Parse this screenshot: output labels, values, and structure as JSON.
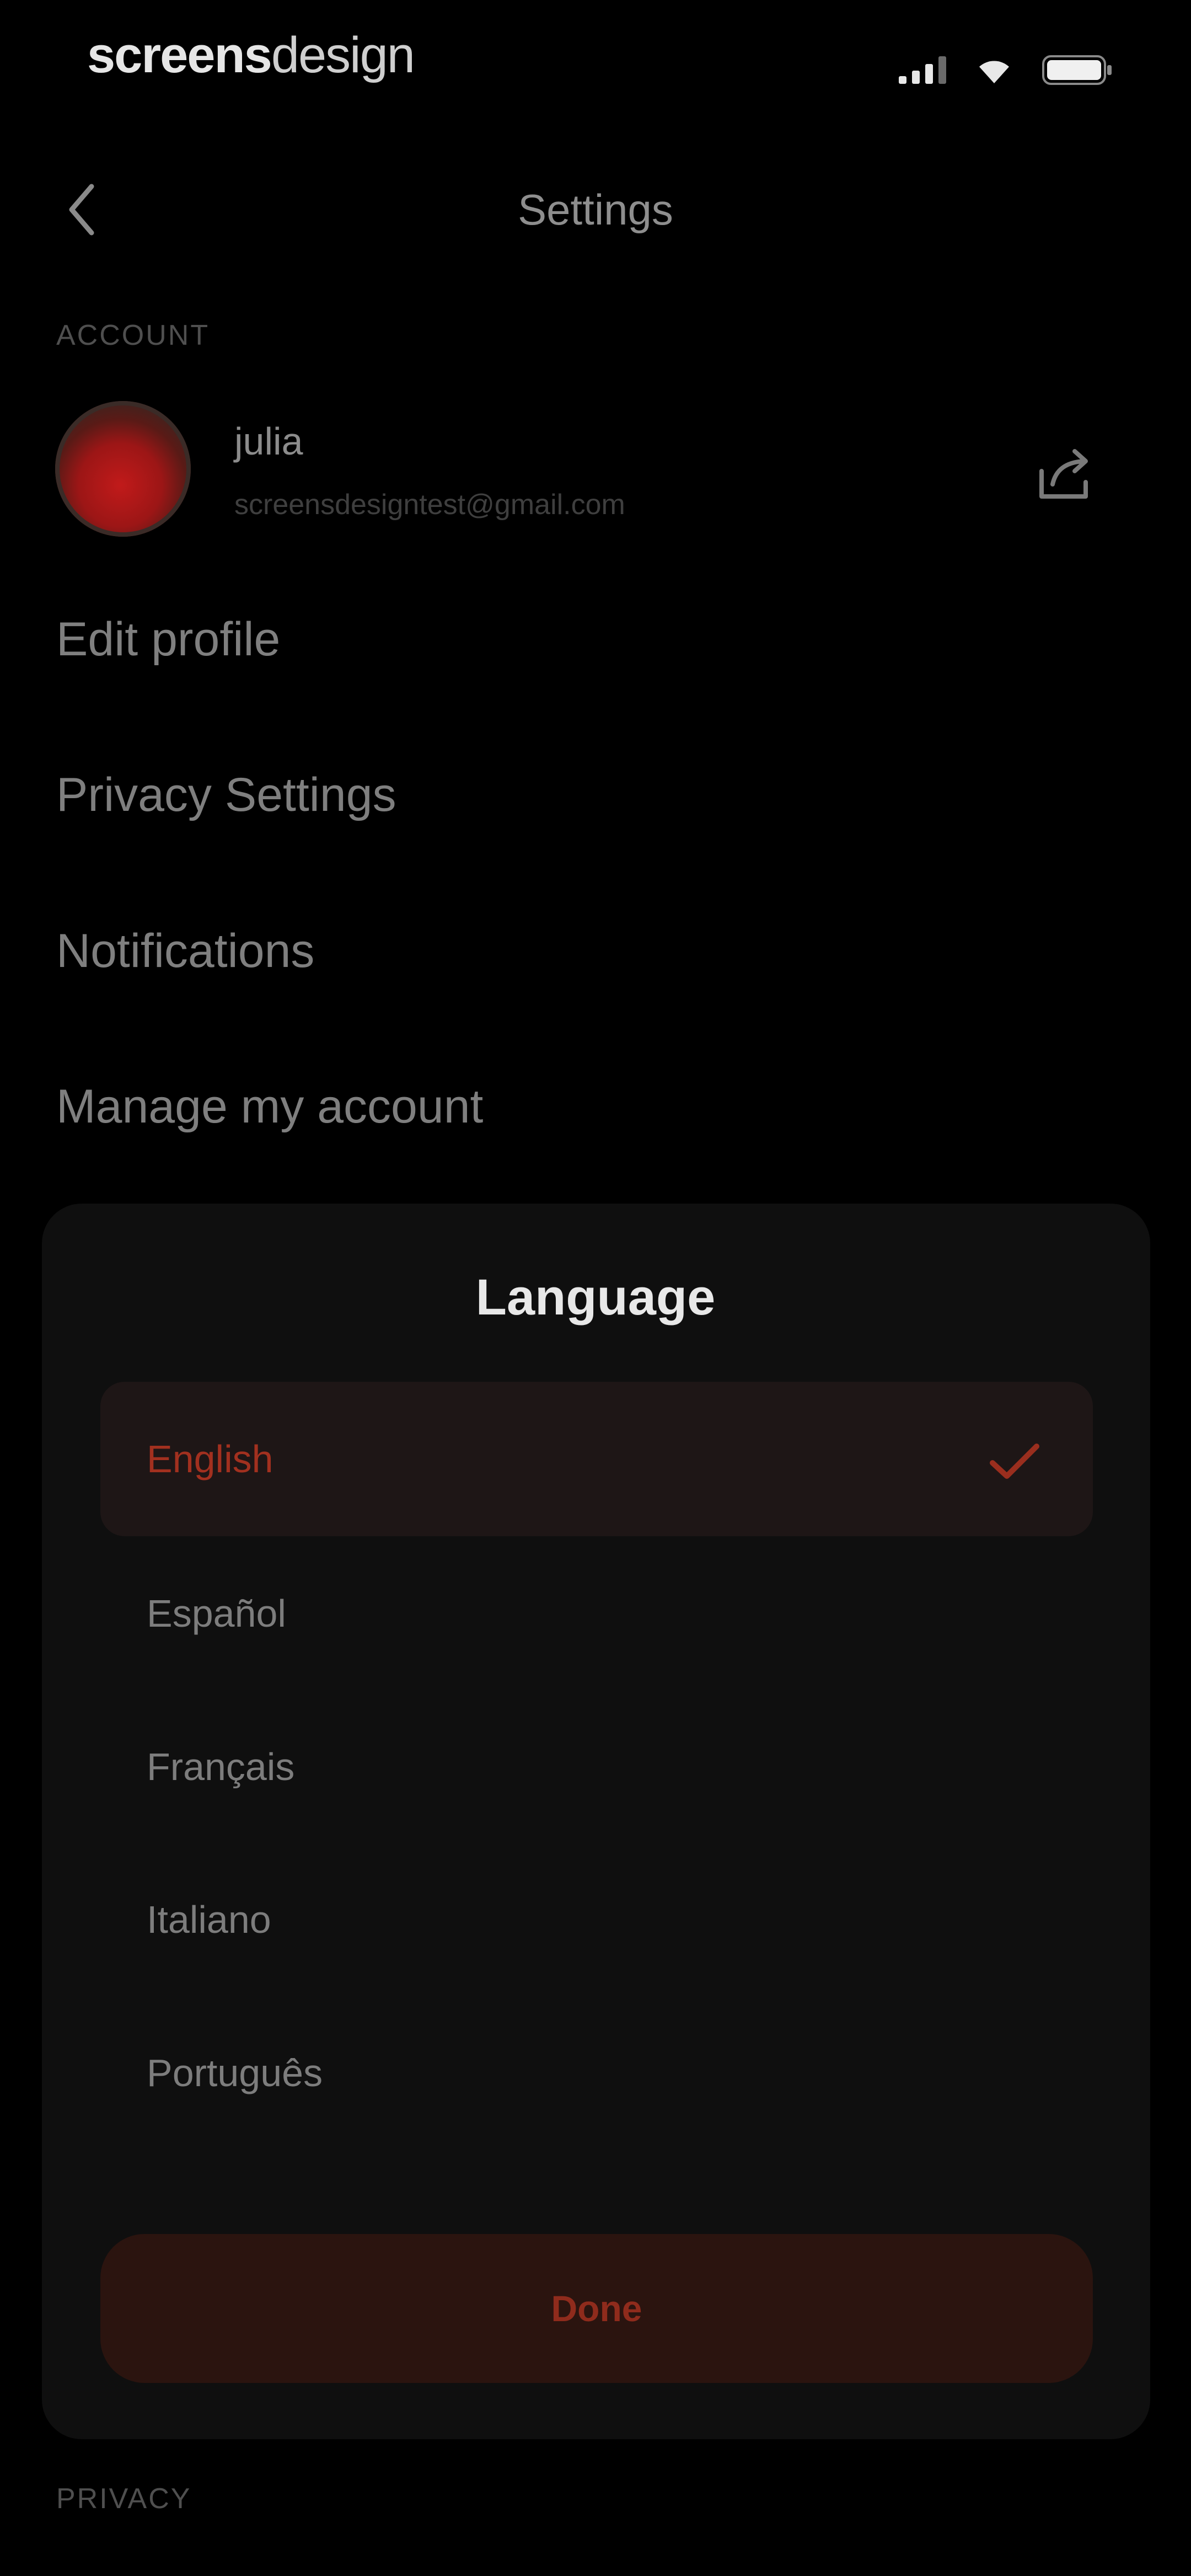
{
  "status_bar": {
    "brand_bold": "screens",
    "brand_light": "design"
  },
  "header": {
    "title": "Settings"
  },
  "account": {
    "section_label": "ACCOUNT",
    "name": "julia",
    "email": "screensdesigntest@gmail.com"
  },
  "menu": {
    "items": [
      {
        "label": "Edit profile"
      },
      {
        "label": "Privacy Settings"
      },
      {
        "label": "Notifications"
      },
      {
        "label": "Manage my account"
      }
    ]
  },
  "language_sheet": {
    "title": "Language",
    "options": [
      {
        "label": "English",
        "selected": true
      },
      {
        "label": "Español",
        "selected": false
      },
      {
        "label": "Français",
        "selected": false
      },
      {
        "label": "Italiano",
        "selected": false
      },
      {
        "label": "Português",
        "selected": false
      }
    ],
    "done_label": "Done"
  },
  "privacy": {
    "section_label": "PRIVACY"
  },
  "colors": {
    "background": "#000000",
    "sheet": "#0f0f0f",
    "accent": "#a2301f",
    "selected_row": "#1e1616",
    "done_button": "#2b140f"
  }
}
